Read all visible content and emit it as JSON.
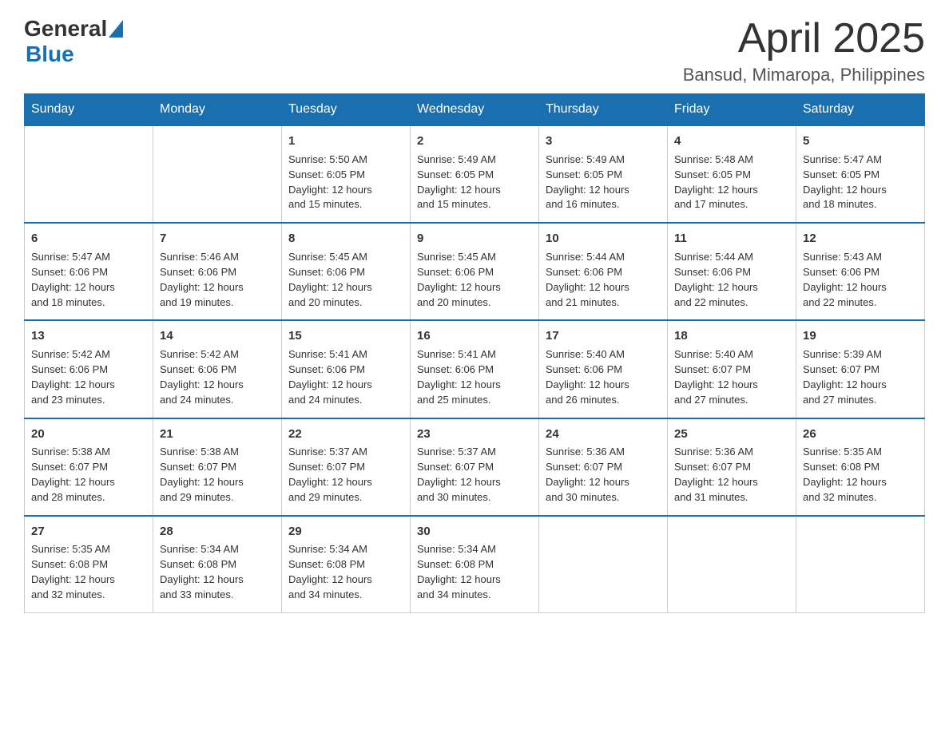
{
  "header": {
    "logo_general": "General",
    "logo_blue": "Blue",
    "month_title": "April 2025",
    "location": "Bansud, Mimaropa, Philippines"
  },
  "weekdays": [
    "Sunday",
    "Monday",
    "Tuesday",
    "Wednesday",
    "Thursday",
    "Friday",
    "Saturday"
  ],
  "weeks": [
    [
      {
        "day": "",
        "info": ""
      },
      {
        "day": "",
        "info": ""
      },
      {
        "day": "1",
        "info": "Sunrise: 5:50 AM\nSunset: 6:05 PM\nDaylight: 12 hours\nand 15 minutes."
      },
      {
        "day": "2",
        "info": "Sunrise: 5:49 AM\nSunset: 6:05 PM\nDaylight: 12 hours\nand 15 minutes."
      },
      {
        "day": "3",
        "info": "Sunrise: 5:49 AM\nSunset: 6:05 PM\nDaylight: 12 hours\nand 16 minutes."
      },
      {
        "day": "4",
        "info": "Sunrise: 5:48 AM\nSunset: 6:05 PM\nDaylight: 12 hours\nand 17 minutes."
      },
      {
        "day": "5",
        "info": "Sunrise: 5:47 AM\nSunset: 6:05 PM\nDaylight: 12 hours\nand 18 minutes."
      }
    ],
    [
      {
        "day": "6",
        "info": "Sunrise: 5:47 AM\nSunset: 6:06 PM\nDaylight: 12 hours\nand 18 minutes."
      },
      {
        "day": "7",
        "info": "Sunrise: 5:46 AM\nSunset: 6:06 PM\nDaylight: 12 hours\nand 19 minutes."
      },
      {
        "day": "8",
        "info": "Sunrise: 5:45 AM\nSunset: 6:06 PM\nDaylight: 12 hours\nand 20 minutes."
      },
      {
        "day": "9",
        "info": "Sunrise: 5:45 AM\nSunset: 6:06 PM\nDaylight: 12 hours\nand 20 minutes."
      },
      {
        "day": "10",
        "info": "Sunrise: 5:44 AM\nSunset: 6:06 PM\nDaylight: 12 hours\nand 21 minutes."
      },
      {
        "day": "11",
        "info": "Sunrise: 5:44 AM\nSunset: 6:06 PM\nDaylight: 12 hours\nand 22 minutes."
      },
      {
        "day": "12",
        "info": "Sunrise: 5:43 AM\nSunset: 6:06 PM\nDaylight: 12 hours\nand 22 minutes."
      }
    ],
    [
      {
        "day": "13",
        "info": "Sunrise: 5:42 AM\nSunset: 6:06 PM\nDaylight: 12 hours\nand 23 minutes."
      },
      {
        "day": "14",
        "info": "Sunrise: 5:42 AM\nSunset: 6:06 PM\nDaylight: 12 hours\nand 24 minutes."
      },
      {
        "day": "15",
        "info": "Sunrise: 5:41 AM\nSunset: 6:06 PM\nDaylight: 12 hours\nand 24 minutes."
      },
      {
        "day": "16",
        "info": "Sunrise: 5:41 AM\nSunset: 6:06 PM\nDaylight: 12 hours\nand 25 minutes."
      },
      {
        "day": "17",
        "info": "Sunrise: 5:40 AM\nSunset: 6:06 PM\nDaylight: 12 hours\nand 26 minutes."
      },
      {
        "day": "18",
        "info": "Sunrise: 5:40 AM\nSunset: 6:07 PM\nDaylight: 12 hours\nand 27 minutes."
      },
      {
        "day": "19",
        "info": "Sunrise: 5:39 AM\nSunset: 6:07 PM\nDaylight: 12 hours\nand 27 minutes."
      }
    ],
    [
      {
        "day": "20",
        "info": "Sunrise: 5:38 AM\nSunset: 6:07 PM\nDaylight: 12 hours\nand 28 minutes."
      },
      {
        "day": "21",
        "info": "Sunrise: 5:38 AM\nSunset: 6:07 PM\nDaylight: 12 hours\nand 29 minutes."
      },
      {
        "day": "22",
        "info": "Sunrise: 5:37 AM\nSunset: 6:07 PM\nDaylight: 12 hours\nand 29 minutes."
      },
      {
        "day": "23",
        "info": "Sunrise: 5:37 AM\nSunset: 6:07 PM\nDaylight: 12 hours\nand 30 minutes."
      },
      {
        "day": "24",
        "info": "Sunrise: 5:36 AM\nSunset: 6:07 PM\nDaylight: 12 hours\nand 30 minutes."
      },
      {
        "day": "25",
        "info": "Sunrise: 5:36 AM\nSunset: 6:07 PM\nDaylight: 12 hours\nand 31 minutes."
      },
      {
        "day": "26",
        "info": "Sunrise: 5:35 AM\nSunset: 6:08 PM\nDaylight: 12 hours\nand 32 minutes."
      }
    ],
    [
      {
        "day": "27",
        "info": "Sunrise: 5:35 AM\nSunset: 6:08 PM\nDaylight: 12 hours\nand 32 minutes."
      },
      {
        "day": "28",
        "info": "Sunrise: 5:34 AM\nSunset: 6:08 PM\nDaylight: 12 hours\nand 33 minutes."
      },
      {
        "day": "29",
        "info": "Sunrise: 5:34 AM\nSunset: 6:08 PM\nDaylight: 12 hours\nand 34 minutes."
      },
      {
        "day": "30",
        "info": "Sunrise: 5:34 AM\nSunset: 6:08 PM\nDaylight: 12 hours\nand 34 minutes."
      },
      {
        "day": "",
        "info": ""
      },
      {
        "day": "",
        "info": ""
      },
      {
        "day": "",
        "info": ""
      }
    ]
  ]
}
